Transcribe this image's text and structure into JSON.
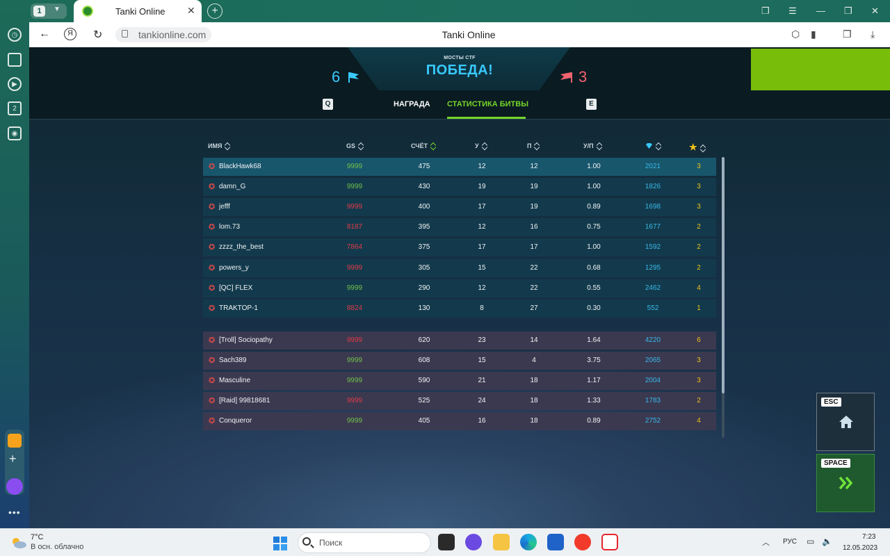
{
  "browser": {
    "tab_count": "1",
    "tab_title": "Tanki Online",
    "url": "tankionline.com",
    "page_title": "Tanki Online"
  },
  "sidebar": {
    "counter_badge": "2"
  },
  "battle": {
    "map_name": "МОСТЫ CTF",
    "result": "ПОБЕДА!",
    "score_blue": "6",
    "score_red": "3",
    "key_prev": "Q",
    "key_next": "E",
    "tabs": [
      {
        "label": "НАГРАДА",
        "active": false
      },
      {
        "label": "СТАТИСТИКА БИТВЫ",
        "active": true
      }
    ],
    "accent_color": "#76d52a",
    "blue_color": "#39c9ff",
    "red_color": "#f0626e"
  },
  "table": {
    "columns": [
      "ИМЯ",
      "GS",
      "СЧЁТ",
      "У",
      "П",
      "У/П"
    ],
    "column_icons": [
      "crystal-icon",
      "star-icon"
    ],
    "sorted_column": "СЧЁТ",
    "blue_team": [
      {
        "name": "BlackHawk68",
        "gs": "9999",
        "gs_color": "green",
        "score": "475",
        "kills": "12",
        "deaths": "12",
        "kd": "1.00",
        "crystals": "2021",
        "stars": "3",
        "highlight": true
      },
      {
        "name": "damn_G",
        "gs": "9999",
        "gs_color": "green",
        "score": "430",
        "kills": "19",
        "deaths": "19",
        "kd": "1.00",
        "crystals": "1826",
        "stars": "3"
      },
      {
        "name": "jefff",
        "gs": "9999",
        "gs_color": "red",
        "score": "400",
        "kills": "17",
        "deaths": "19",
        "kd": "0.89",
        "crystals": "1698",
        "stars": "3"
      },
      {
        "name": "lom.73",
        "gs": "8187",
        "gs_color": "red",
        "score": "395",
        "kills": "12",
        "deaths": "16",
        "kd": "0.75",
        "crystals": "1677",
        "stars": "2"
      },
      {
        "name": "zzzz_the_best",
        "gs": "7864",
        "gs_color": "red",
        "score": "375",
        "kills": "17",
        "deaths": "17",
        "kd": "1.00",
        "crystals": "1592",
        "stars": "2"
      },
      {
        "name": "powers_y",
        "gs": "9999",
        "gs_color": "red",
        "score": "305",
        "kills": "15",
        "deaths": "22",
        "kd": "0.68",
        "crystals": "1295",
        "stars": "2"
      },
      {
        "name": "[QC] FLEX",
        "gs": "9999",
        "gs_color": "green",
        "score": "290",
        "kills": "12",
        "deaths": "22",
        "kd": "0.55",
        "crystals": "2462",
        "stars": "4"
      },
      {
        "name": "TRAKTOP-1",
        "gs": "8824",
        "gs_color": "red",
        "score": "130",
        "kills": "8",
        "deaths": "27",
        "kd": "0.30",
        "crystals": "552",
        "stars": "1"
      }
    ],
    "red_team": [
      {
        "name": "[Troll] Sociopathy",
        "gs": "9999",
        "gs_color": "red",
        "score": "620",
        "kills": "23",
        "deaths": "14",
        "kd": "1.64",
        "crystals": "4220",
        "stars": "6"
      },
      {
        "name": "Sach389",
        "gs": "9999",
        "gs_color": "green",
        "score": "608",
        "kills": "15",
        "deaths": "4",
        "kd": "3.75",
        "crystals": "2065",
        "stars": "3"
      },
      {
        "name": "Masculine",
        "gs": "9999",
        "gs_color": "green",
        "score": "590",
        "kills": "21",
        "deaths": "18",
        "kd": "1.17",
        "crystals": "2004",
        "stars": "3"
      },
      {
        "name": "[Raid] 99818681",
        "gs": "9999",
        "gs_color": "red",
        "score": "525",
        "kills": "24",
        "deaths": "18",
        "kd": "1.33",
        "crystals": "1783",
        "stars": "2"
      },
      {
        "name": "Conqueror",
        "gs": "9999",
        "gs_color": "green",
        "score": "405",
        "kills": "16",
        "deaths": "18",
        "kd": "0.89",
        "crystals": "2752",
        "stars": "4"
      }
    ]
  },
  "actions": {
    "home_key": "ESC",
    "next_key": "SPACE"
  },
  "taskbar": {
    "temperature": "7°C",
    "weather": "В осн. облачно",
    "search_placeholder": "Поиск",
    "language": "РУС",
    "time": "7:23",
    "date": "12.05.2023"
  }
}
